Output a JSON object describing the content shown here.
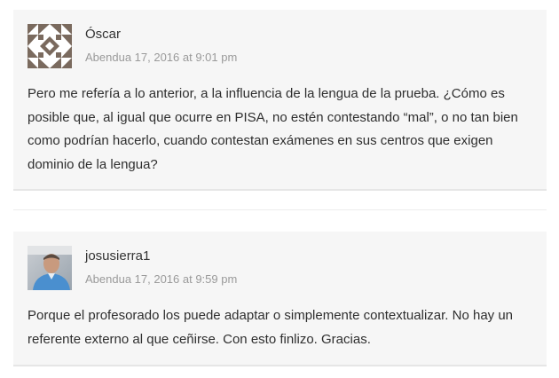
{
  "comments": [
    {
      "author": "Óscar",
      "date": "Abendua 17, 2016 at 9:01 pm",
      "text": "Pero me refería a lo anterior, a la influencia de la lengua de la prueba. ¿Cómo es posible que, al igual que ocurre en PISA, no estén contestando “mal”, o no tan bien como podrían hacerlo, cuando contestan exámenes en sus centros que exigen dominio de la lengua?",
      "avatar": "identicon-avatar"
    },
    {
      "author": "josusierra1",
      "date": "Abendua 17, 2016 at 9:59 pm",
      "text": "Porque el profesorado los puede adaptar o simplemente contextualizar. No hay un referente externo al que ceñirse. Con esto finlizo. Gracias.",
      "avatar": "photo-avatar"
    }
  ],
  "colors": {
    "card_bg": "#f6f6f6",
    "identicon": "#7a6a5e",
    "date_text": "#9a9a9a"
  }
}
